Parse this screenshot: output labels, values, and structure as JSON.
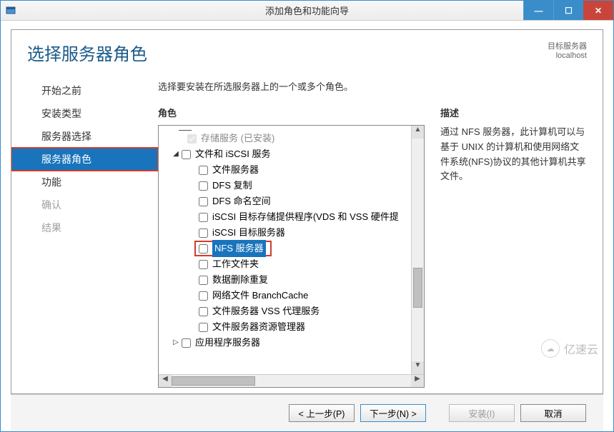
{
  "window": {
    "title": "添加角色和功能向导",
    "controls": {
      "min": "—",
      "max": "☐",
      "close": "✕"
    }
  },
  "heading": "选择服务器角色",
  "target": {
    "label": "目标服务器",
    "name": "localhost"
  },
  "nav": {
    "items": [
      {
        "label": "开始之前",
        "state": "normal"
      },
      {
        "label": "安装类型",
        "state": "normal"
      },
      {
        "label": "服务器选择",
        "state": "normal"
      },
      {
        "label": "服务器角色",
        "state": "active"
      },
      {
        "label": "功能",
        "state": "normal"
      },
      {
        "label": "确认",
        "state": "disabled"
      },
      {
        "label": "结果",
        "state": "disabled"
      }
    ]
  },
  "instruction": "选择要安装在所选服务器上的一个或多个角色。",
  "roles_label": "角色",
  "desc_label": "描述",
  "desc_text": "通过 NFS 服务器，此计算机可以与基于 UNIX 的计算机和使用网络文件系统(NFS)协议的其他计算机共享文件。",
  "tree": {
    "storage_installed": "存储服务 (已安装)",
    "file_iscsi": "文件和 iSCSI 服务",
    "file_server": "文件服务器",
    "dfs_rep": "DFS 复制",
    "dfs_ns": "DFS 命名空间",
    "iscsi_target_provider": "iSCSI 目标存储提供程序(VDS 和 VSS 硬件提",
    "iscsi_target_server": "iSCSI 目标服务器",
    "nfs_server": "NFS 服务器",
    "work_folders": "工作文件夹",
    "data_dedup": "数据删除重复",
    "branchcache": "网络文件 BranchCache",
    "vss_agent": "文件服务器 VSS 代理服务",
    "fsrm": "文件服务器资源管理器",
    "app_server": "应用程序服务器"
  },
  "buttons": {
    "prev": "< 上一步(P)",
    "next": "下一步(N) >",
    "install": "安装(I)",
    "cancel": "取消"
  },
  "watermark": "亿速云"
}
